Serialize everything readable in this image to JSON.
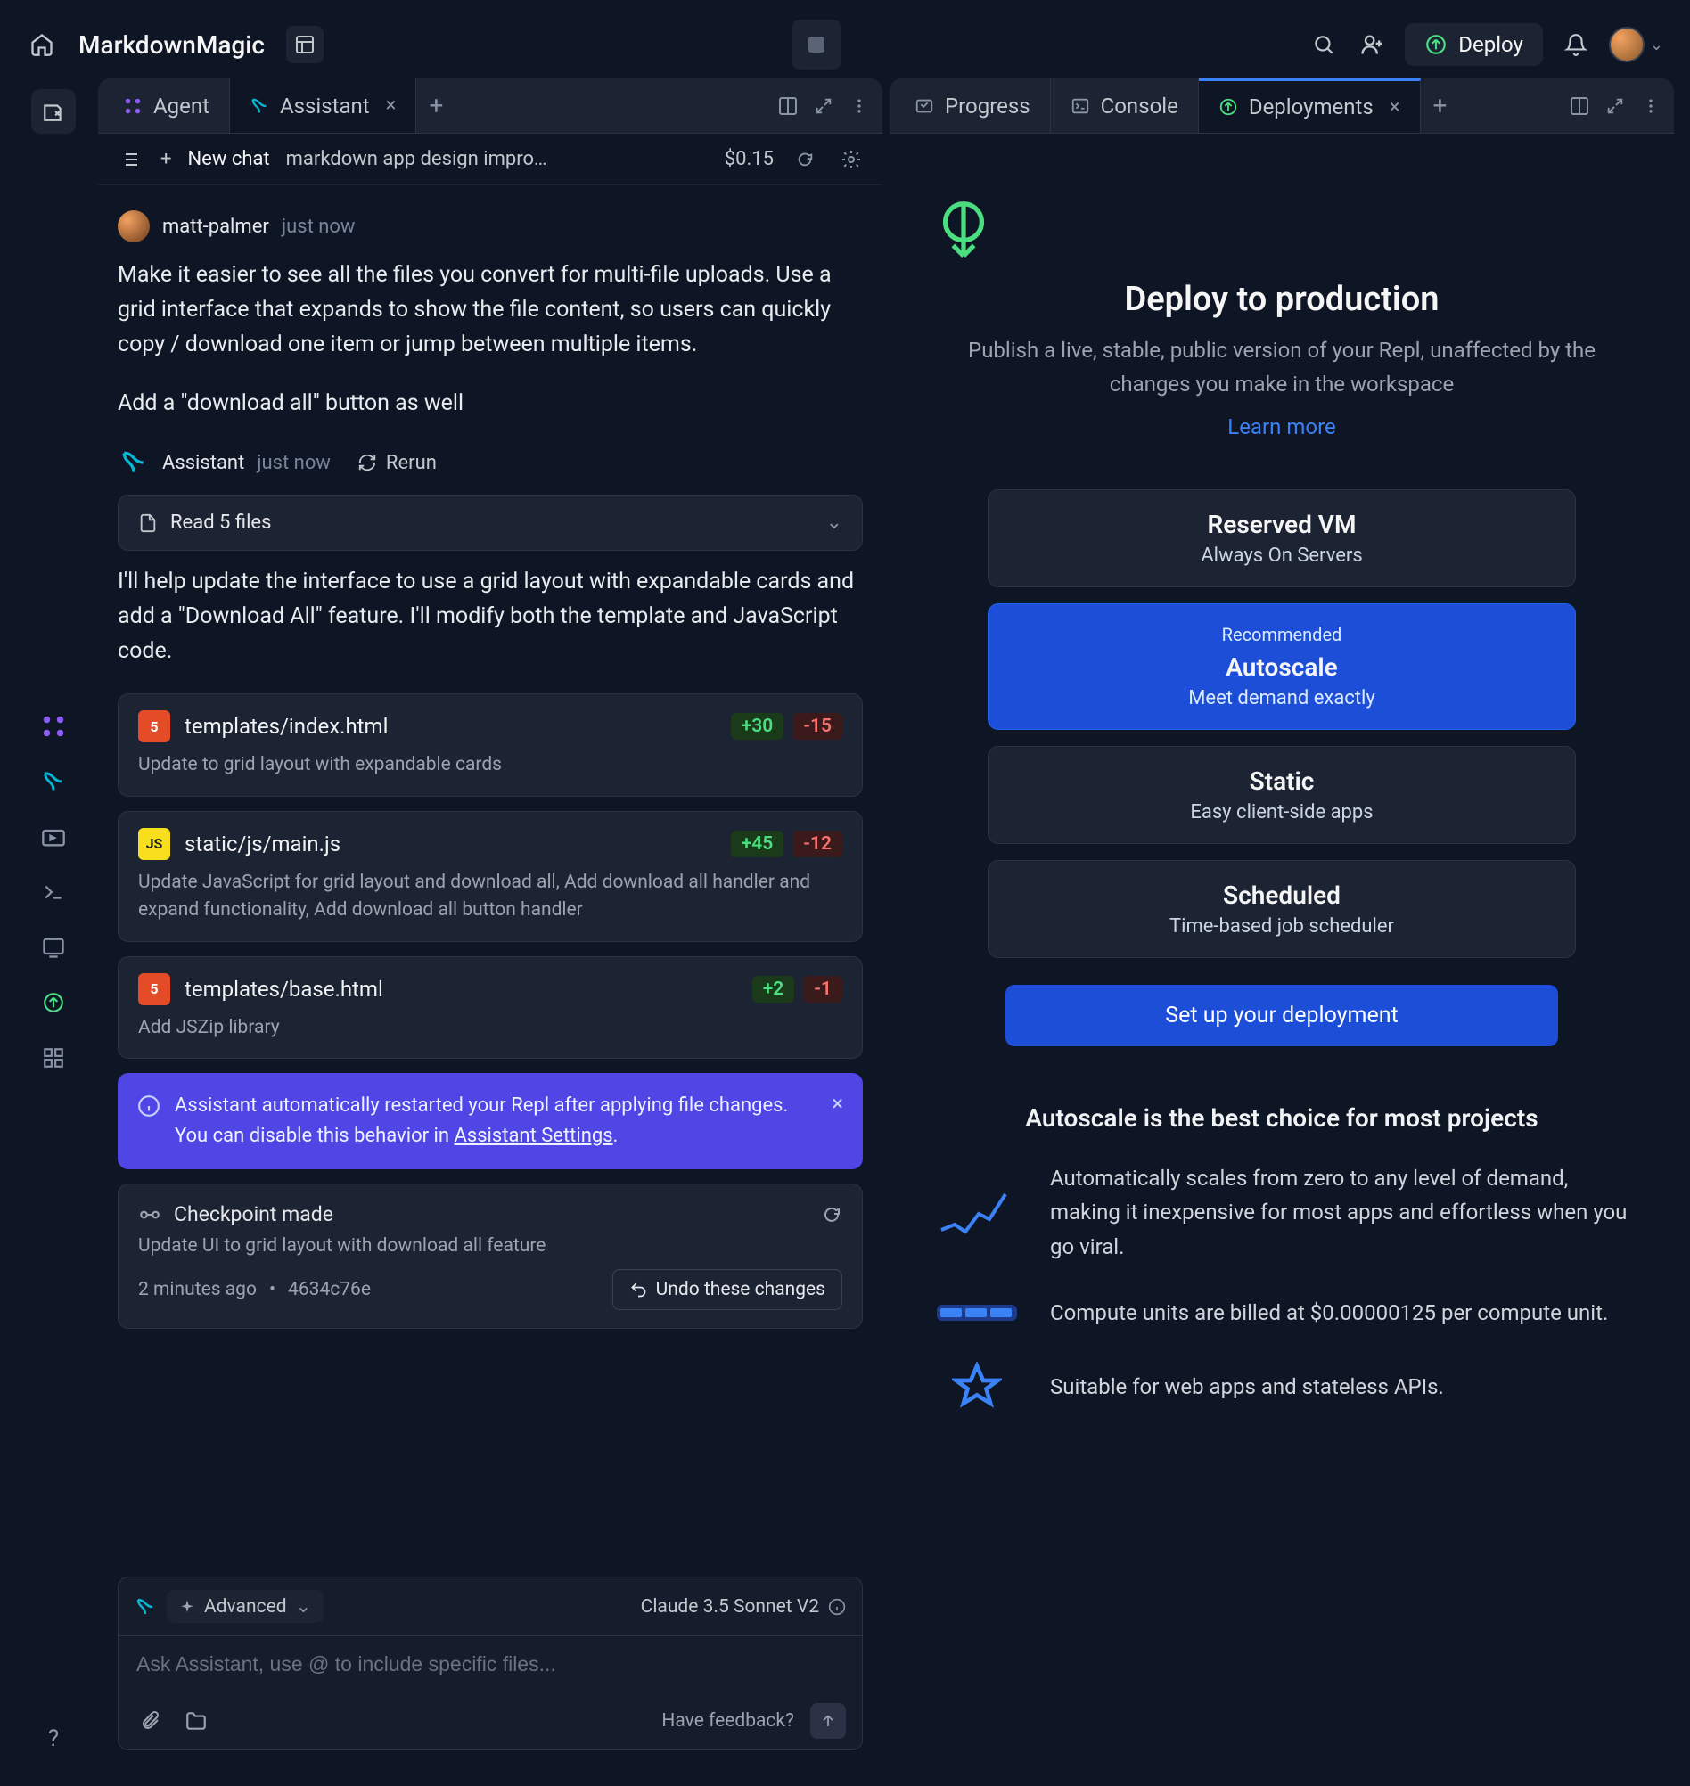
{
  "header": {
    "project": "MarkdownMagic",
    "deploy_label": "Deploy"
  },
  "left_tabs": {
    "agent": "Agent",
    "assistant": "Assistant"
  },
  "chat_header": {
    "new_chat": "New chat",
    "thread": "markdown app design improv…",
    "price": "$0.15"
  },
  "user_msg": {
    "name": "matt-palmer",
    "time": "just now",
    "body1": "Make it easier to see all the files you convert for multi-file uploads. Use a grid interface that expands to show the file content, so users can quickly copy / download one item or jump between multiple items.",
    "body2": "Add a \"download all\" button as well"
  },
  "assistant_msg": {
    "name": "Assistant",
    "time": "just now",
    "rerun": "Rerun",
    "read_files": "Read 5 files",
    "body": "I'll help update the interface to use a grid layout with expandable cards and add a \"Download All\" feature. I'll modify both the template and JavaScript code."
  },
  "files": [
    {
      "badge": "5",
      "name": "templates/index.html",
      "plus": "+30",
      "minus": "-15",
      "desc": "Update to grid layout with expandable cards"
    },
    {
      "badge": "JS",
      "name": "static/js/main.js",
      "plus": "+45",
      "minus": "-12",
      "desc": "Update JavaScript for grid layout and download all, Add download all handler and expand functionality, Add download all button handler"
    },
    {
      "badge": "5",
      "name": "templates/base.html",
      "plus": "+2",
      "minus": "-1",
      "desc": "Add JSZip library"
    }
  ],
  "banner": {
    "text_pre": "Assistant automatically restarted your Repl after applying file changes. You can disable this behavior in ",
    "link": "Assistant Settings",
    "text_post": "."
  },
  "checkpoint": {
    "title": "Checkpoint made",
    "desc": "Update UI to grid layout with download all feature",
    "time": "2 minutes ago",
    "hash": "4634c76e",
    "undo": "Undo these changes"
  },
  "composer": {
    "advanced": "Advanced",
    "model": "Claude 3.5 Sonnet V2",
    "placeholder": "Ask Assistant, use @ to include specific files...",
    "feedback": "Have feedback?"
  },
  "right_tabs": {
    "progress": "Progress",
    "console": "Console",
    "deployments": "Deployments"
  },
  "deploy": {
    "title": "Deploy to production",
    "sub": "Publish a live, stable, public version of your Repl, unaffected by the changes you make in the workspace",
    "learn": "Learn more",
    "options": [
      {
        "title": "Reserved VM",
        "sub": "Always On Servers",
        "rec": false
      },
      {
        "title": "Autoscale",
        "sub": "Meet demand exactly",
        "rec": true,
        "badge": "Recommended"
      },
      {
        "title": "Static",
        "sub": "Easy client-side apps",
        "rec": false
      },
      {
        "title": "Scheduled",
        "sub": "Time-based job scheduler",
        "rec": false
      }
    ],
    "setup": "Set up your deployment",
    "why_title": "Autoscale is the best choice for most projects",
    "why": [
      "Automatically scales from zero to any level of demand, making it inexpensive for most apps and effortless when you go viral.",
      "Compute units are billed at $0.00000125 per compute unit.",
      "Suitable for web apps and stateless APIs."
    ]
  }
}
